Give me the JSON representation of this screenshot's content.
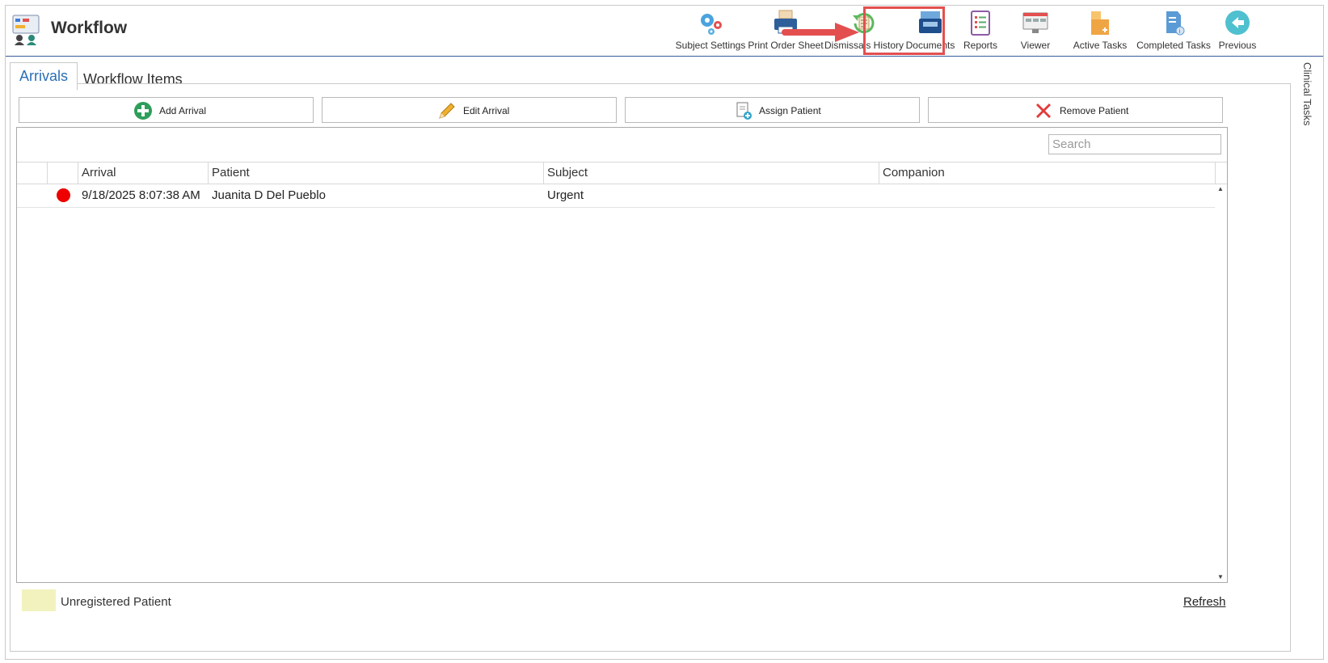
{
  "app": {
    "title": "Workflow"
  },
  "toolbar": {
    "subject_settings": "Subject Settings",
    "print_order_sheet": "Print Order Sheet",
    "dismissals_history": "Dismissals History",
    "documents": "Documents",
    "reports": "Reports",
    "viewer": "Viewer",
    "active_tasks": "Active Tasks",
    "completed_tasks": "Completed Tasks",
    "previous": "Previous"
  },
  "tabs": {
    "arrivals": "Arrivals",
    "workflow_items": "Workflow Items"
  },
  "side_panel": {
    "label": "Clinical Tasks"
  },
  "actions": {
    "add_arrival": "Add Arrival",
    "edit_arrival": "Edit Arrival",
    "assign_patient": "Assign Patient",
    "remove_patient": "Remove Patient"
  },
  "search": {
    "placeholder": "Search"
  },
  "grid": {
    "columns": {
      "arrival": "Arrival",
      "patient": "Patient",
      "subject": "Subject",
      "companion": "Companion"
    },
    "rows": [
      {
        "status_color": "#ee0000",
        "arrival": "9/18/2025 8:07:38 AM",
        "patient": "Juanita D Del Pueblo",
        "subject": "Urgent",
        "companion": ""
      }
    ]
  },
  "footer": {
    "legend_label": "Unregistered Patient",
    "legend_color": "#f2f2be",
    "refresh": "Refresh"
  },
  "colors": {
    "accent": "#2a6fb6",
    "highlight": "#e34f4f",
    "header_line": "#3a5c9e"
  }
}
